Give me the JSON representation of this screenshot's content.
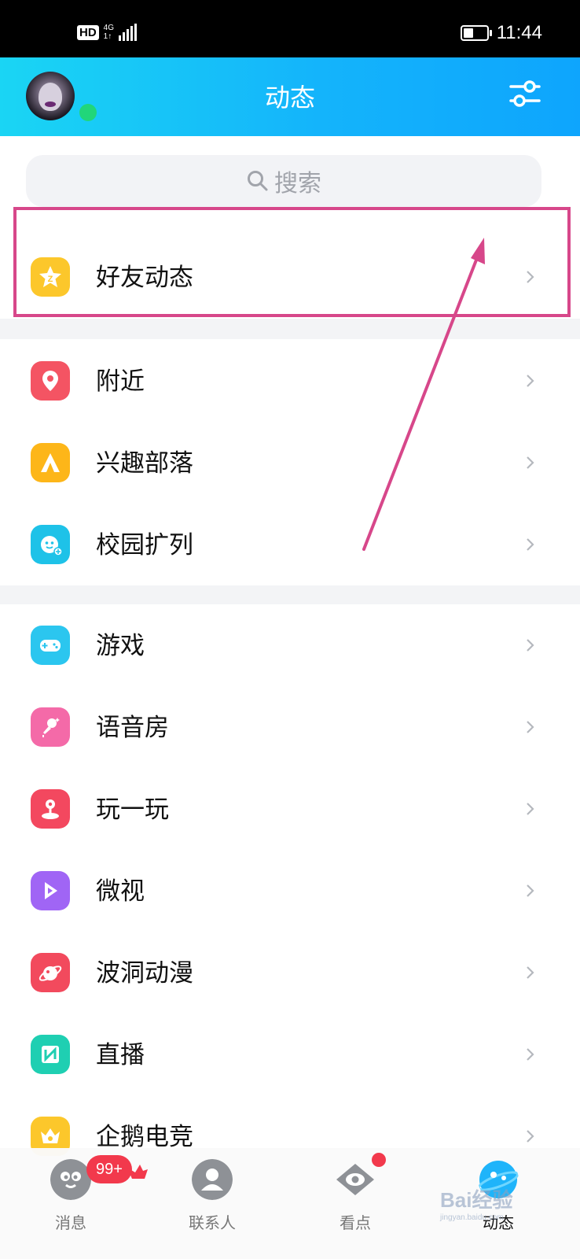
{
  "status_bar": {
    "hd": "HD",
    "network": "4G",
    "network_sub": "1↑",
    "battery_level": 0.45,
    "time": "11:44"
  },
  "header": {
    "title": "动态",
    "avatar_icon": "avatar-image",
    "filter_icon": "sliders-icon"
  },
  "search": {
    "placeholder": "搜索"
  },
  "sections": [
    {
      "items": [
        {
          "label": "好友动态",
          "icon": "qzone-star-icon",
          "color": "#fcc72b"
        }
      ]
    },
    {
      "items": [
        {
          "label": "附近",
          "icon": "location-pin-icon",
          "color": "#f45463"
        },
        {
          "label": "兴趣部落",
          "icon": "tent-icon",
          "color": "#fdb619"
        },
        {
          "label": "校园扩列",
          "icon": "campus-face-icon",
          "color": "#1ec2e8"
        }
      ]
    },
    {
      "items": [
        {
          "label": "游戏",
          "icon": "gamepad-icon",
          "color": "#2bc6ef"
        },
        {
          "label": "语音房",
          "icon": "microphone-icon",
          "color": "#f46aa8"
        },
        {
          "label": "玩一玩",
          "icon": "joystick-icon",
          "color": "#f3485f"
        },
        {
          "label": "微视",
          "icon": "play-icon",
          "color": "#a065f5"
        },
        {
          "label": "波洞动漫",
          "icon": "planet-icon",
          "color": "#f24a5d"
        },
        {
          "label": "直播",
          "icon": "live-n-icon",
          "color": "#1fcfb2"
        },
        {
          "label": "企鹅电竞",
          "icon": "crown-icon",
          "color": "#fcc72b"
        }
      ]
    }
  ],
  "tabbar": {
    "tabs": [
      {
        "label": "消息",
        "icon": "penguin-message-icon",
        "active": false
      },
      {
        "label": "联系人",
        "icon": "contacts-icon",
        "active": false
      },
      {
        "label": "看点",
        "icon": "eye-icon",
        "active": false
      },
      {
        "label": "动态",
        "icon": "planet-active-icon",
        "active": true
      }
    ],
    "message_badge": "99+"
  },
  "watermark": {
    "text": "Bai经验",
    "url": "jingyan.baidu.com"
  },
  "colors": {
    "header_start": "#1ad5f4",
    "header_end": "#0ea5fd",
    "highlight": "#d7478a",
    "badge": "#f2394c"
  }
}
